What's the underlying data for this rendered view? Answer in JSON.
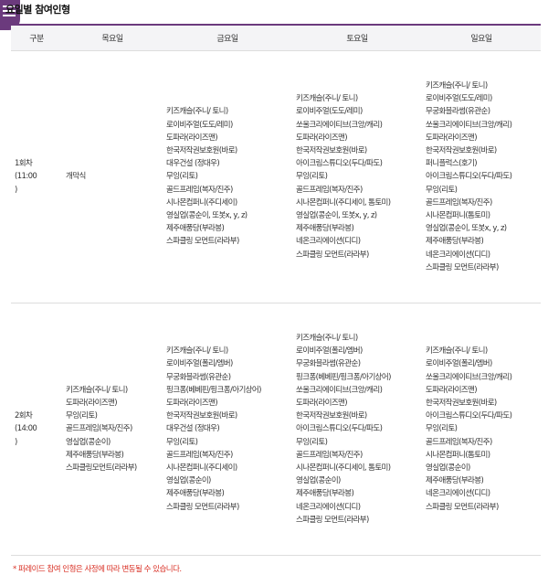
{
  "title": "요일별 참여인형",
  "columns": [
    "구분",
    "목요일",
    "금요일",
    "토요일",
    "일요일"
  ],
  "rows": [
    {
      "round": [
        "1회차",
        "(11:00",
        ")"
      ],
      "thu": [
        "개막식"
      ],
      "fri": [
        "키즈캐슬(주니/ 토니)",
        "로이비주얼(도도/레미)",
        "도파라(라이즈맨)",
        "한국저작권보호원(바로)",
        "대우건설 (정대우)",
        "무잉(리토)",
        "골드프레임(복자/진주)",
        "시나몬컴퍼니(주디세이)",
        "영실업(콩순이, 또봇x, y, z)",
        "제주애풍당(부라봉)",
        "스파클링 모먼트(라라부)"
      ],
      "sat": [
        "키즈캐슬(주니/ 토니)",
        "로이비주얼(도도/레미)",
        "쏘울크리에이티브(크앙/캐리)",
        "도파라(라이즈맨)",
        "한국저작권보호원(바로)",
        "아이크림스튜디오(두다/파도)",
        "무잉(리토)",
        "골드프레임(복자/진주)",
        "시나몬컴퍼니(주디세이, 톰토미)",
        "영실업(콩순이, 또봇x, y, z)",
        "제주애풍당(부라봉)",
        "네온크리에이션(디디)",
        "스파클링 모먼트(라라부)"
      ],
      "sun": [
        "키즈캐슬(주니/ 토니)",
        "로이비주얼(도도/레미)",
        "무궁화블라썸(유관순)",
        "쏘울크리에이티브(크앙/캐리)",
        "도파라(라이즈맨)",
        "한국저작권보호원(바로)",
        "퍼니플럭스(호기)",
        "아이크림스튜디오(두다/파도)",
        "무잉(리토)",
        "골드프레임(복자/진주)",
        "시나몬컴퍼니(톰토미)",
        "영실업(콩순이, 또봇x, y, z)",
        "제주애풍당(부라봉)",
        "네온크리에이션(디디)",
        "스파클링 모먼트(라라부)"
      ]
    },
    {
      "round": [
        "2회차",
        "(14:00",
        ")"
      ],
      "thu": [
        "키즈캐슬(주니/ 토니)",
        "도파라(라이즈맨)",
        "무잉(리토)",
        "골드프레임(복자/진주)",
        "영실업(콩순이)",
        "제주애풍당(부라봉)",
        "스파클링모먼트(라라부)"
      ],
      "fri": [
        "키즈캐슬(주니/ 토니)",
        "로이비주얼(폴리/엠버)",
        "무궁화블라썸(유관순)",
        "핑크퐁(베베핀/핑크퐁/아기상어)",
        "도파라(라이즈맨)",
        "한국저작권보호원(바로)",
        "대우건설 (정대우)",
        "무잉(리토)",
        "골드프레임(복자/진주)",
        "시나몬컴퍼니(주디세이)",
        "영실업(콩순이)",
        "제주애풍당(부라봉)",
        "스파클링 모먼트(라라부)"
      ],
      "sat": [
        "키즈캐슬(주니/ 토니)",
        "로이비주얼(폴리/엠버)",
        "무궁화블라썸(유관순)",
        "핑크퐁(베베핀/핑크퐁/아기상어)",
        "쏘울크리에이티브(크앙/캐리)",
        "도파라(라이즈맨)",
        "한국저작권보호원(바로)",
        "아이크림스튜디오(두다/파도)",
        "무잉(리토)",
        "골드프레임(복자/진주)",
        "시나몬컴퍼니(주디세이, 톰토미)",
        "영실업(콩순이)",
        "제주애풍당(부라봉)",
        "네온크리에이션(디디)",
        "스파클링 모먼트(라라부)"
      ],
      "sun": [
        "키즈캐슬(주니/ 토니)",
        "로이비주얼(폴리/엠버)",
        "쏘울크리에이티브(크앙/캐리)",
        "도파라(라이즈맨)",
        "한국저작권보호원(바로)",
        "아이크림스튜디오(두다/파도)",
        "무잉(리토)",
        "골드프레임(복자/진주)",
        "시나몬컴퍼니(톰토미)",
        "영실업(콩순이)",
        "제주애풍당(부라봉)",
        "네온크리에이션(디디)",
        "스파클링 모먼트(라라부)"
      ]
    }
  ],
  "note": "* 퍼레이드 참여 인형은 사정에 따라 변동될 수 있습니다.",
  "colors": {
    "accent": "#6b3a7d",
    "note": "#d93025",
    "header_bg": "#f4f4f6"
  },
  "icons": {
    "menu": "menu-icon"
  }
}
